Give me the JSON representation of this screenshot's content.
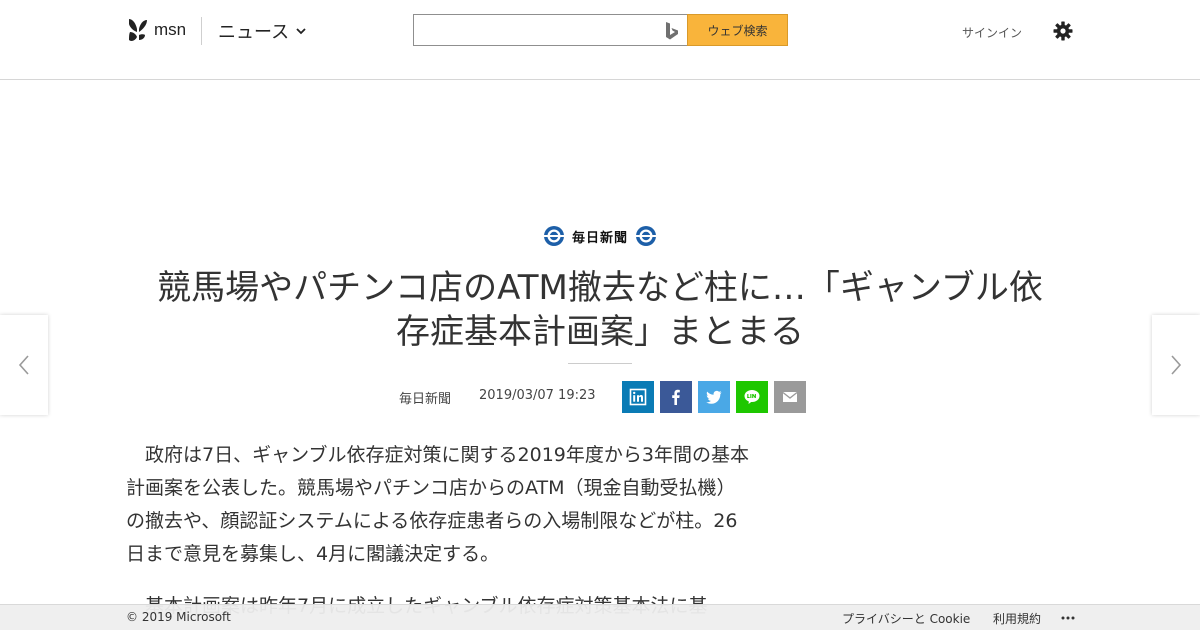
{
  "header": {
    "logo_text": "msn",
    "category": "ニュース",
    "search_placeholder": "",
    "search_button": "ウェブ検索",
    "signin": "サインイン"
  },
  "article": {
    "publisher": "毎日新聞",
    "title_line1": "競馬場やパチンコ店のATM撤去など柱に…「ギャンブル依",
    "title_line2": "存症基本計画案」まとまる",
    "source": "毎日新聞",
    "date": "2019/03/07 19:23",
    "paragraphs": [
      "　政府は7日、ギャンブル依存症対策に関する2019年度から3年間の基本計画案を公表した。競馬場やパチンコ店からのATM（現金自動受払機）の撤去や、顔認証システムによる依存症患者らの入場制限などが柱。26日まで意見を募集し、4月に閣議決定する。",
      "　基本計画案は昨年7月に成立したギャンブル依存症対策基本法に基"
    ]
  },
  "footer": {
    "copyright": "© 2019 Microsoft",
    "privacy": "プライバシーと Cookie",
    "terms": "利用規約"
  },
  "colors": {
    "search_button": "#f9b43b",
    "linkedin": "#0a7bb5",
    "facebook": "#3b5998",
    "twitter": "#4aa8e6",
    "line": "#1ec700",
    "mail": "#9a9a9a"
  },
  "icons": [
    "msn-butterfly-icon",
    "chevron-down-icon",
    "bing-icon",
    "gear-icon",
    "chevron-left-icon",
    "chevron-right-icon",
    "publisher-emblem-icon",
    "linkedin-icon",
    "facebook-icon",
    "twitter-icon",
    "line-icon",
    "mail-icon",
    "more-icon"
  ]
}
